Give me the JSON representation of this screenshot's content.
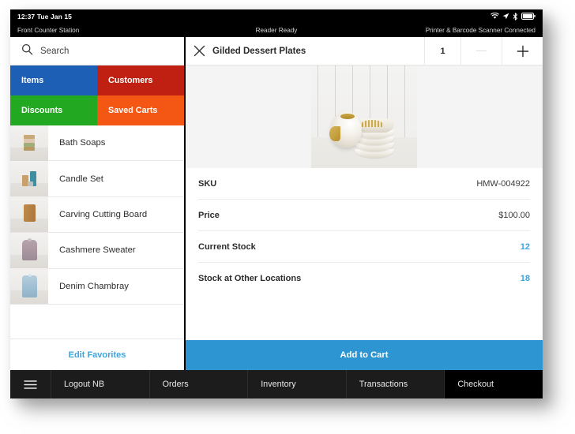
{
  "status_bar": {
    "time": "12:37 Tue Jan 15",
    "icons": [
      "wifi-icon",
      "location-arrow-icon",
      "bluetooth-icon",
      "battery-icon"
    ]
  },
  "sub_bar": {
    "station": "Front Counter Station",
    "reader": "Reader Ready",
    "peripherals": "Printer & Barcode Scanner Connected"
  },
  "search": {
    "placeholder": "Search",
    "icon": "search-icon"
  },
  "tiles": [
    {
      "label": "Items",
      "color": "#1c5fb5"
    },
    {
      "label": "Customers",
      "color": "#bf2011"
    },
    {
      "label": "Discounts",
      "color": "#22a821"
    },
    {
      "label": "Saved Carts",
      "color": "#f35713"
    }
  ],
  "favorites": {
    "items": [
      {
        "label": "Bath Soaps"
      },
      {
        "label": "Candle Set"
      },
      {
        "label": "Carving Cutting Board"
      },
      {
        "label": "Cashmere Sweater"
      },
      {
        "label": "Denim Chambray"
      }
    ],
    "edit_label": "Edit Favorites",
    "edit_color": "#3ba3e0"
  },
  "item_detail": {
    "close_icon": "close-icon",
    "title": "Gilded Dessert Plates",
    "quantity": "1",
    "minus_icon": "minus-icon",
    "plus_icon": "plus-icon",
    "image_alt": "gilded-dessert-plates-photo",
    "rows": [
      {
        "label": "SKU",
        "value": "HMW-004922",
        "accent": false
      },
      {
        "label": "Price",
        "value": "$100.00",
        "accent": false
      },
      {
        "label": "Current Stock",
        "value": "12",
        "accent": true
      },
      {
        "label": "Stock at Other Locations",
        "value": "18",
        "accent": true
      }
    ],
    "add_to_cart_label": "Add to Cart",
    "add_to_cart_color": "#2c95d2"
  },
  "bottom_nav": {
    "menu_icon": "hamburger-menu-icon",
    "items": [
      {
        "label": "Logout NB",
        "active": false
      },
      {
        "label": "Orders",
        "active": false
      },
      {
        "label": "Inventory",
        "active": false
      },
      {
        "label": "Transactions",
        "active": false
      },
      {
        "label": "Checkout",
        "active": true
      }
    ]
  }
}
